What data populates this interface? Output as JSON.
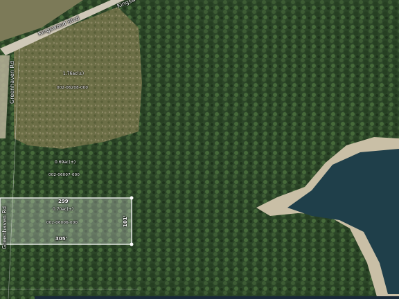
{
  "roads": {
    "kingswood_main": "Kingswood Blvd",
    "kingswood_partial": "Kingsw",
    "greenhaven_top": "Greenhaven Rd",
    "greenhaven_bottom": "Greenhaven Rd"
  },
  "parcels": [
    {
      "acres": "1.76ac(±)",
      "parcel_id": "002-06208-000"
    },
    {
      "acres": "0.69ac(±)",
      "parcel_id": "002-06007-000"
    },
    {
      "acres": "0.70ac(±)",
      "parcel_id": "002-06006-000",
      "dimensions": {
        "top": "299'",
        "bottom": "305'",
        "right": "101'"
      },
      "highlighted": true
    }
  ],
  "colors": {
    "forest": "#2f4a2a",
    "cleared_land": "#7d7a55",
    "water": "#1f3f4a",
    "shore": "#c9bfa6",
    "road": "#cfc8b8",
    "parcel_outline": "#ffffff"
  }
}
